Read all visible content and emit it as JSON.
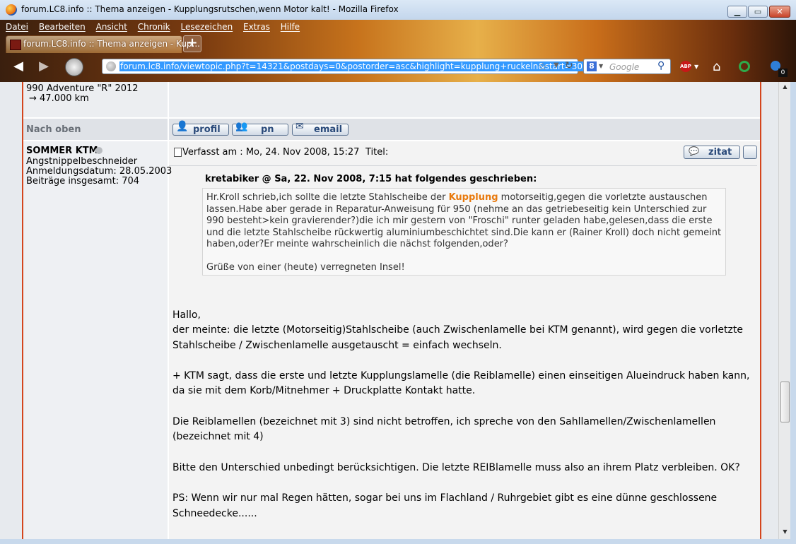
{
  "window": {
    "title": "forum.LC8.info :: Thema anzeigen - Kupplungsrutschen,wenn Motor kalt! - Mozilla Firefox",
    "min_symbol": "▁",
    "max_symbol": "▭",
    "close_symbol": "✕"
  },
  "menu": [
    "Datei",
    "Bearbeiten",
    "Ansicht",
    "Chronik",
    "Lesezeichen",
    "Extras",
    "Hilfe"
  ],
  "tab": {
    "label": "forum.LC8.info :: Thema anzeigen - Kup...",
    "new_tab_symbol": "+"
  },
  "toolbar": {
    "url": "forum.lc8.info/viewtopic.php?t=14321&postdays=0&postorder=asc&highlight=kupplung+ruckeln&start=30",
    "search_placeholder": "Google",
    "search_engine_letter": "8",
    "abp_label": "ABP",
    "addon_badge": "0",
    "back_symbol": "◀",
    "forward_symbol": "▶",
    "star_symbol": "☆",
    "dropdown_symbol": "▼",
    "reload_symbol": "↻",
    "search_symbol": "⚲",
    "home_symbol": "⌂"
  },
  "prev_post": {
    "signature_bike": "990 Adventure \"R\" 2012",
    "signature_km": "→  47.000 km",
    "nav_top": "Nach oben",
    "buttons": {
      "profil": "profil",
      "pn": "pn",
      "email": "email"
    }
  },
  "post": {
    "author": "SOMMER KTM",
    "rank": "Angstnippelbeschneider",
    "joined": "Anmeldungsdatum: 28.05.2003",
    "post_count": "Beiträge insgesamt: 704",
    "posted_at": "Verfasst am : Mo, 24. Nov 2008, 15:27",
    "subject_label": "Titel:",
    "quote_button": "zitat",
    "quote": {
      "header": "kretabiker @ Sa, 22. Nov 2008, 7:15 hat folgendes geschrieben:",
      "line1_pre": "Hr.Kroll schrieb,ich sollte die letzte Stahlscheibe der ",
      "line1_highlight": "Kupplung",
      "line1_post": " motorseitig,gegen die vorletzte austauschen",
      "line2": "lassen.Habe aber gerade in Reparatur-Anweisung für 950 (nehme an das getriebeseitig kein Unterschied zur",
      "line3": "990 besteht>kein gravierender?)die ich mir gestern von \"Froschi\" runter geladen habe,gelesen,dass die erste",
      "line4": "und die letzte Stahlscheibe rückwertig aluminiumbeschichtet sind.Die kann er (Rainer Kroll) doch nicht gemeint",
      "line5": "haben,oder?Er meinte wahrscheinlich die nächst folgenden,oder?",
      "line6": "Grüße von einer (heute) verregneten Insel!"
    },
    "body": [
      "Hallo,",
      "der meinte: die letzte (Motorseitig)Stahlscheibe (auch Zwischenlamelle bei KTM genannt), wird gegen die vorletzte",
      "Stahlscheibe / Zwischenlamelle ausgetauscht = einfach wechseln.",
      "+ KTM sagt, dass die erste und letzte Kupplungslamelle (die Reiblamelle) einen einseitigen Alueindruck haben kann,",
      "da sie mit dem Korb/Mitnehmer + Druckplatte Kontakt hatte.",
      "Die Reiblamellen (bezeichnet mit 3) sind nicht betroffen, ich spreche von den Sahllamellen/Zwischenlamellen",
      "(bezeichnet mit 4)",
      "Bitte den Unterschied unbedingt berücksichtigen. Die letzte REIBlamelle muss also an ihrem Platz verbleiben. OK?",
      "PS: Wenn wir nur mal Regen hätten, sogar bei uns im Flachland / Ruhrgebiet gibt es eine dünne geschlossene",
      "Schneedecke......"
    ]
  },
  "scrollbar": {
    "up": "▲",
    "down": "▼"
  },
  "colors": {
    "frame_red": "#d4451d",
    "highlight": "#e8790c",
    "button_text": "#2a4a7a"
  }
}
